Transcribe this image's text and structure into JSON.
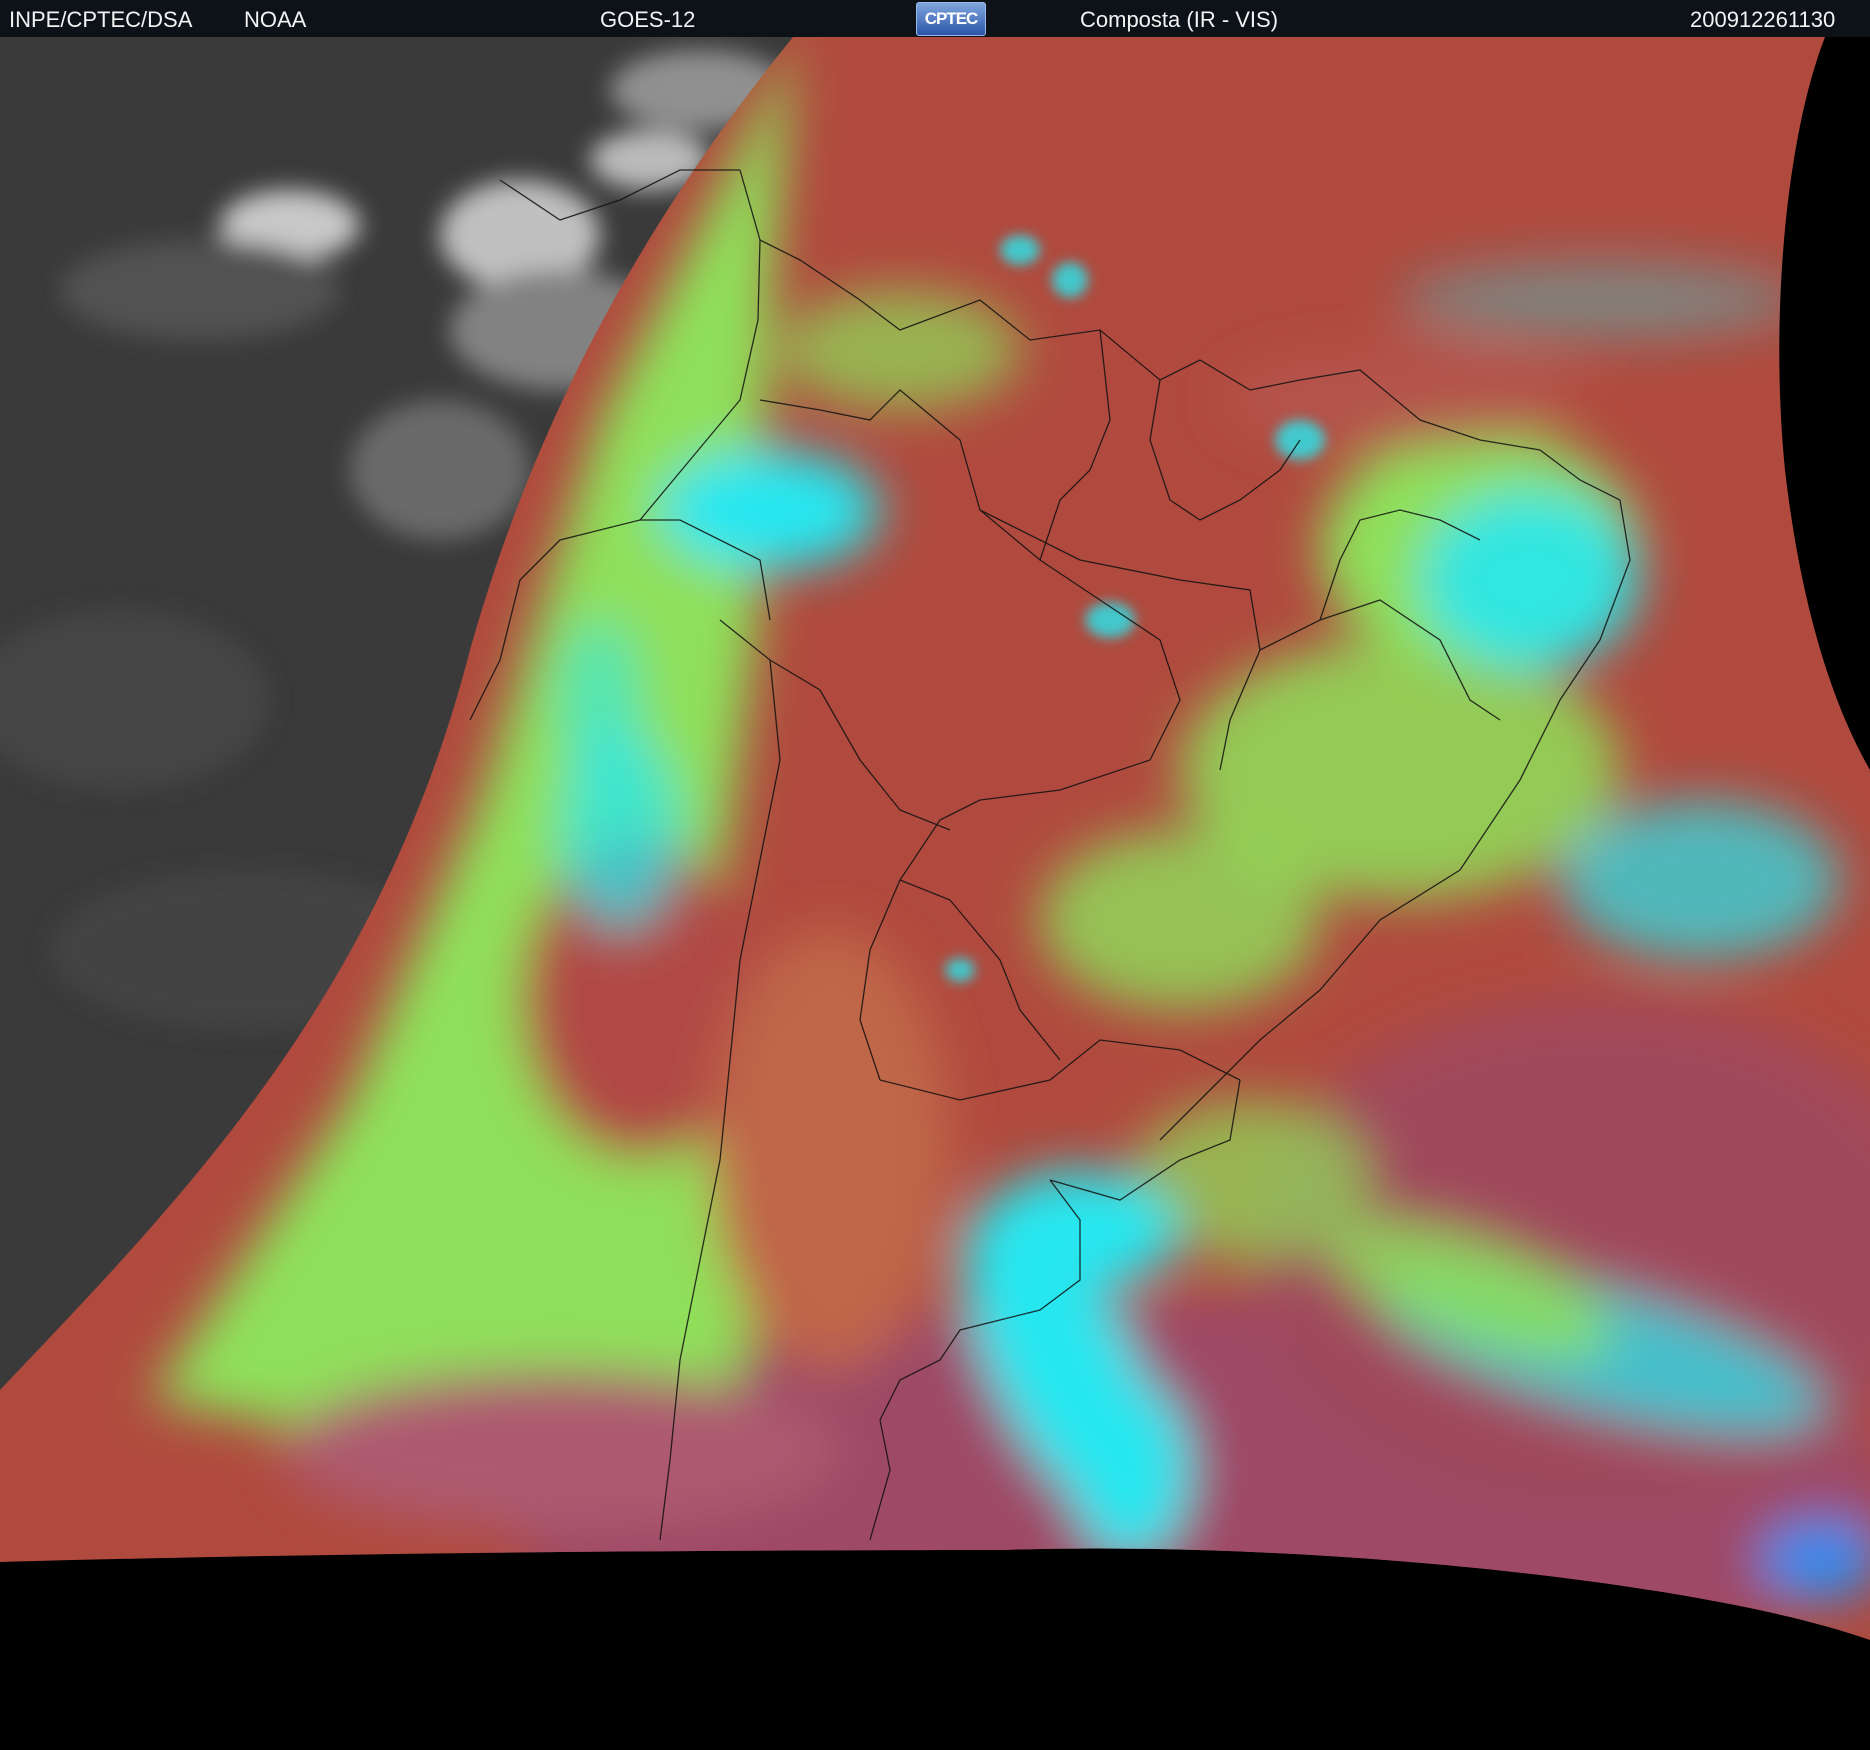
{
  "header": {
    "agency": "INPE/CPTEC/DSA",
    "provider": "NOAA",
    "satellite": "GOES-12",
    "logo_text": "CPTEC",
    "product": "Composta (IR - VIS)",
    "timestamp": "200912261130"
  },
  "palette": {
    "background": "#000000",
    "header_bg": "#0d1219",
    "ir_gray": "#3a3a3a",
    "land_red": "#b04a3e",
    "ocean_red": "#a84a55",
    "cloud_green": "#8fe05a",
    "cloud_cyan": "#27e7f0",
    "border_lines": "#111111"
  }
}
